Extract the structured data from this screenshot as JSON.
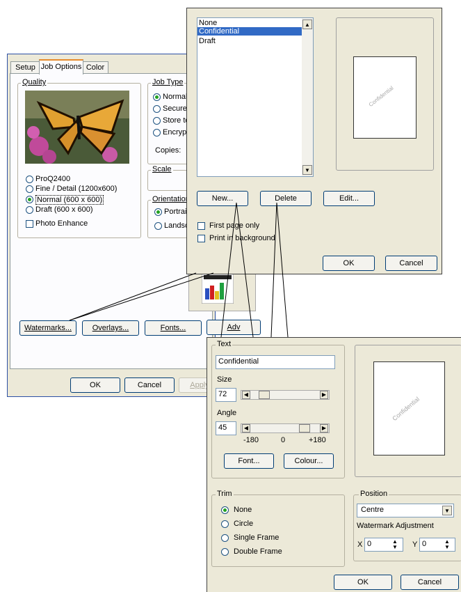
{
  "left_dialog": {
    "tabs": [
      "Setup",
      "Job Options",
      "Color"
    ],
    "quality": {
      "group_label": "Quality",
      "options": [
        "ProQ2400",
        "Fine / Detail (1200x600)",
        "Normal (600 x 600)",
        "Draft (600 x 600)"
      ],
      "selected": "Normal (600 x 600)",
      "photo_enhance": "Photo Enhance"
    },
    "job_type": {
      "group_label": "Job Type",
      "options": [
        "Normal",
        "Secure",
        "Store to",
        "Encrypt"
      ],
      "selected": "Normal",
      "copies_label": "Copies:"
    },
    "scale_label": "Scale",
    "orientation": {
      "group_label": "Orientation",
      "options": [
        "Portrait",
        "Landsc"
      ],
      "selected": "Portrait"
    },
    "buttons": {
      "watermarks": "Watermarks...",
      "overlays": "Overlays...",
      "fonts": "Fonts...",
      "advanced": "Adv"
    },
    "footer": {
      "ok": "OK",
      "cancel": "Cancel",
      "apply": "Apply"
    }
  },
  "watermark_dialog": {
    "list_items": [
      "None",
      "Confidential",
      "Draft"
    ],
    "selected_item": "Confidential",
    "preview_text": "Confidential",
    "buttons": {
      "new": "New...",
      "delete": "Delete",
      "edit": "Edit..."
    },
    "first_page_only": "First page only",
    "print_in_background": "Print in background",
    "ok": "OK",
    "cancel": "Cancel"
  },
  "edit_dialog": {
    "text_group": "Text",
    "text_value": "Confidential",
    "size_label": "Size",
    "size_value": "72",
    "angle_label": "Angle",
    "angle_value": "45",
    "angle_ticks": [
      "-180",
      "0",
      "+180"
    ],
    "font_button": "Font...",
    "colour_button": "Colour...",
    "preview_text": "Confidential",
    "trim": {
      "group_label": "Trim",
      "options": [
        "None",
        "Circle",
        "Single Frame",
        "Double Frame"
      ],
      "selected": "None"
    },
    "position": {
      "group_label": "Position",
      "selected": "Centre",
      "adjustment_label": "Watermark Adjustment",
      "x_label": "X",
      "x_value": "0",
      "y_label": "Y",
      "y_value": "0"
    },
    "ok": "OK",
    "cancel": "Cancel"
  },
  "colors": {
    "selection": "#316ac5",
    "dialog_bg": "#ece9d8"
  }
}
